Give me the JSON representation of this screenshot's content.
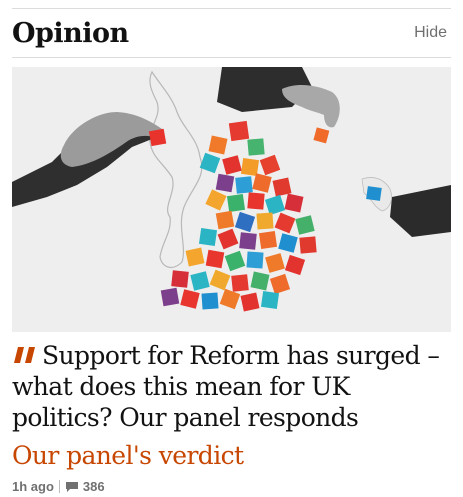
{
  "section": {
    "title": "Opinion",
    "hide_label": "Hide"
  },
  "article": {
    "headline": "Support for Reform has surged – what does this mean for UK politics? Our panel responds",
    "kicker": "Our panel's verdict",
    "time_ago": "1h ago",
    "comment_count": "386",
    "quote_icon": "quote-icon",
    "comment_icon": "comment-icon"
  },
  "colors": {
    "accent": "#c74600",
    "text": "#121212",
    "muted": "#707070"
  }
}
